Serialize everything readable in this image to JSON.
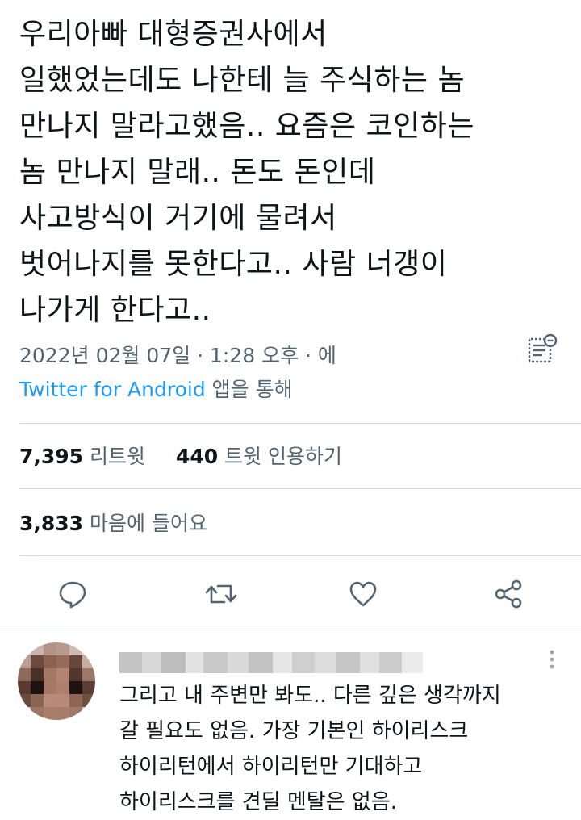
{
  "tweet": {
    "lines": [
      "우리아빠 대형증권사에서",
      "일했었는데도 나한테 늘 주식하는 놈",
      "만나지 말라고했음.. 요즘은 코인하는",
      "놈 만나지 말래.. 돈도 돈인데",
      "사고방식이 거기에 물려서",
      "벗어나지를 못한다고.. 사람 너갱이",
      "나가게 한다고.."
    ],
    "timestamp": "2022년 02월 07일 · 1:28 오후 · 에",
    "via_app": "Twitter for Android",
    "via_suffix": " 앱을 통해"
  },
  "stats": {
    "retweets_count": "7,395",
    "retweets_label": " 리트윗",
    "quotes_count": "440",
    "quotes_label": " 트윗 인용하기",
    "likes_count": "3,833",
    "likes_label": " 마음에 들어요"
  },
  "icons": {
    "reply": "reply-icon",
    "retweet": "retweet-icon",
    "like": "heart-icon",
    "share": "share-icon",
    "analytics": "analytics-icon",
    "more": "more-icon"
  },
  "reply": {
    "lines": [
      "그리고 내 주변만 봐도.. 다른 깊은 생각까지",
      "갈 필요도 없음. 가장 기본인 하이리스크",
      "하이리턴에서 하이리턴만 기대하고",
      "하이리스크를 견딜 멘탈은 없음."
    ]
  },
  "colors": {
    "text": "#0f1419",
    "secondary": "#536471",
    "link": "#1d9bf0",
    "divider": "#cfd9de"
  }
}
